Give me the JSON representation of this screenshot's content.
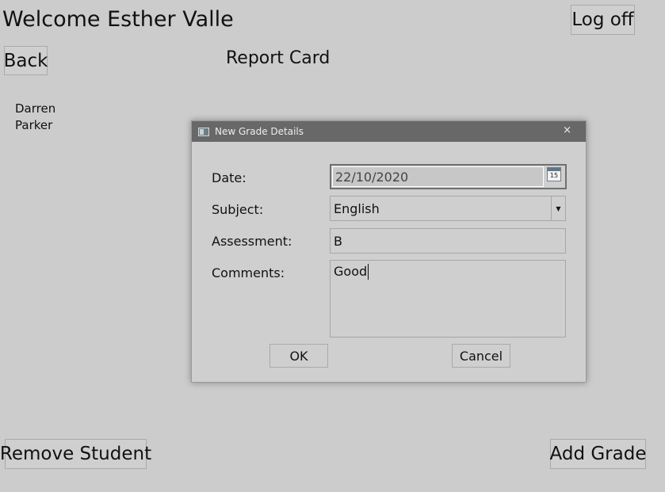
{
  "header": {
    "welcome_text": "Welcome Esther Valle",
    "logoff_label": "Log off",
    "back_label": "Back",
    "page_title": "Report Card"
  },
  "student": {
    "name": "Darren Parker"
  },
  "footer": {
    "remove_student_label": "Remove Student",
    "add_grade_label": "Add Grade"
  },
  "dialog": {
    "title": "New Grade Details",
    "close_glyph": "×",
    "fields": {
      "date_label": "Date:",
      "date_value": "22/10/2020",
      "calendar_icon_text": "15",
      "subject_label": "Subject:",
      "subject_value": "English",
      "assessment_label": "Assessment:",
      "assessment_value": "B",
      "comments_label": "Comments:",
      "comments_value": "Good"
    },
    "ok_label": "OK",
    "cancel_label": "Cancel"
  },
  "icons": {
    "dialog_window_icon": "window-icon",
    "calendar_icon": "calendar-icon",
    "dropdown_icon": "chevron-down-icon"
  },
  "colors": {
    "background": "#cccccc",
    "dialog_titlebar": "#686868"
  }
}
